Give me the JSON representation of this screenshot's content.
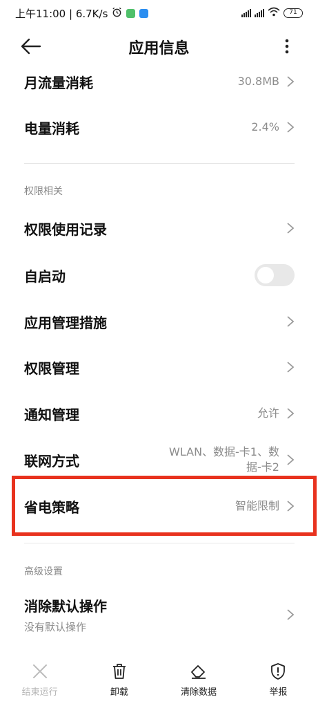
{
  "status_bar": {
    "time_speed": "上午11:00 | 6.7K/s",
    "battery": "71"
  },
  "header": {
    "title": "应用信息"
  },
  "rows": {
    "mobile_data": {
      "label": "月流量消耗",
      "value": "30.8MB"
    },
    "battery_usage": {
      "label": "电量消耗",
      "value": "2.4%"
    }
  },
  "sections": {
    "permissions": "权限相关",
    "advanced": "高级设置"
  },
  "permission_rows": {
    "usage_record": {
      "label": "权限使用记录"
    },
    "autostart": {
      "label": "自启动",
      "on": false
    },
    "app_management": {
      "label": "应用管理措施"
    },
    "permission_management": {
      "label": "权限管理"
    },
    "notifications": {
      "label": "通知管理",
      "value": "允许"
    },
    "network": {
      "label": "联网方式",
      "value_line1": "WLAN、数据-卡1、数",
      "value_line2": "据-卡2"
    },
    "battery_saver": {
      "label": "省电策略",
      "value": "智能限制"
    }
  },
  "advanced_rows": {
    "clear_defaults": {
      "label": "消除默认操作",
      "sub": "没有默认操作"
    }
  },
  "bottom_bar": {
    "force_stop": "结束运行",
    "uninstall": "卸载",
    "clear_data": "清除数据",
    "report": "举报"
  },
  "colors": {
    "highlight": "#e8321e",
    "secondary_text": "#8c8c8c"
  }
}
